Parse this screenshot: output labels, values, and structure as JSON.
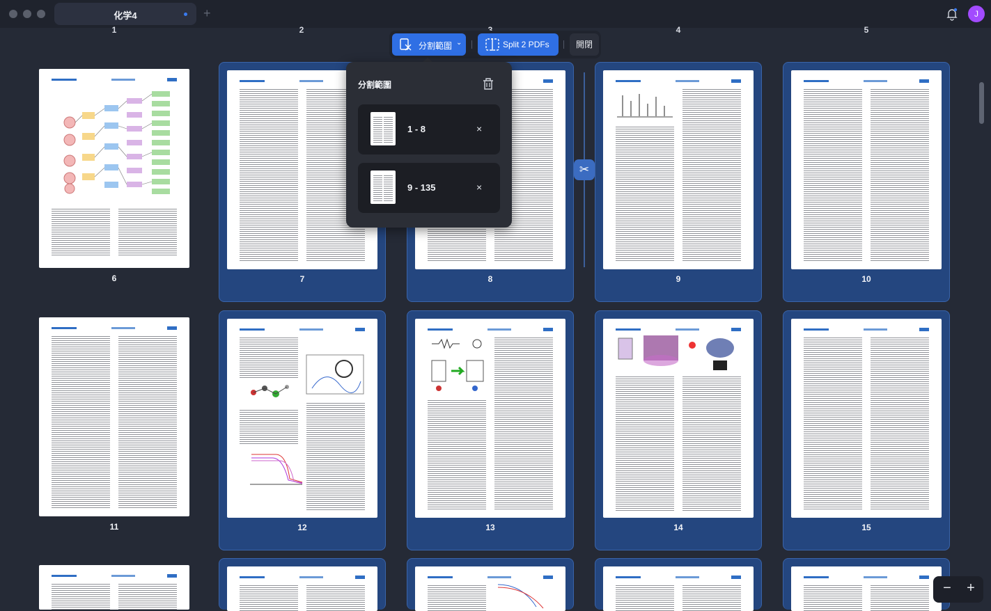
{
  "window": {
    "tab_title": "化学4",
    "new_tab_label": "+",
    "avatar_initial": "J"
  },
  "column_numbers": [
    "1",
    "2",
    "3",
    "4",
    "5"
  ],
  "toolbar": {
    "split_range_label": "分割範圍",
    "split_pdfs_label": "Split 2 PDFs",
    "close_label": "開閉"
  },
  "popover": {
    "title": "分割範圍",
    "ranges": [
      {
        "label": "1 - 8",
        "remove": "×"
      },
      {
        "label": "9 - 135",
        "remove": "×"
      }
    ]
  },
  "pages": {
    "row1": [
      {
        "number": "6",
        "selected": false
      },
      {
        "number": "7",
        "selected": true
      },
      {
        "number": "8",
        "selected": true
      },
      {
        "number": "9",
        "selected": true
      },
      {
        "number": "10",
        "selected": true
      }
    ],
    "row2": [
      {
        "number": "11",
        "selected": false
      },
      {
        "number": "12",
        "selected": true
      },
      {
        "number": "13",
        "selected": true
      },
      {
        "number": "14",
        "selected": true
      },
      {
        "number": "15",
        "selected": true
      }
    ]
  },
  "zoom": {
    "minus": "−",
    "plus": "+"
  },
  "colors": {
    "accent": "#2f6fe4",
    "selection": "#24467f",
    "background": "#252a36",
    "avatar": "#a24bff"
  }
}
